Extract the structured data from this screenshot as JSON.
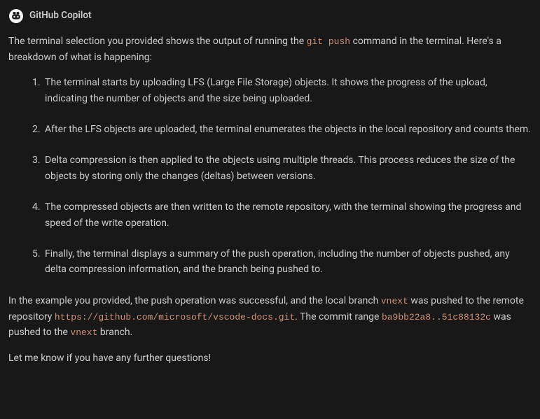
{
  "header": {
    "title": "GitHub Copilot"
  },
  "message": {
    "intro_p1": "The terminal selection you provided shows the output of running the ",
    "intro_code": "git push",
    "intro_p2": " command in the terminal. Here's a breakdown of what is happening:",
    "list": [
      "The terminal starts by uploading LFS (Large File Storage) objects. It shows the progress of the upload, indicating the number of objects and the size being uploaded.",
      "After the LFS objects are uploaded, the terminal enumerates the objects in the local repository and counts them.",
      "Delta compression is then applied to the objects using multiple threads. This process reduces the size of the objects by storing only the changes (deltas) between versions.",
      "The compressed objects are then written to the remote repository, with the terminal showing the progress and speed of the write operation.",
      "Finally, the terminal displays a summary of the push operation, including the number of objects pushed, any delta compression information, and the branch being pushed to."
    ],
    "outro_p1": "In the example you provided, the push operation was successful, and the local branch ",
    "outro_code1": "vnext",
    "outro_p2": " was pushed to the remote repository ",
    "outro_code2": "https://github.com/microsoft/vscode-docs.git",
    "outro_p3": ". The commit range ",
    "outro_code3": "ba9bb22a8..51c88132c",
    "outro_p4": " was pushed to the ",
    "outro_code4": "vnext",
    "outro_p5": " branch.",
    "closing": "Let me know if you have any further questions!"
  }
}
